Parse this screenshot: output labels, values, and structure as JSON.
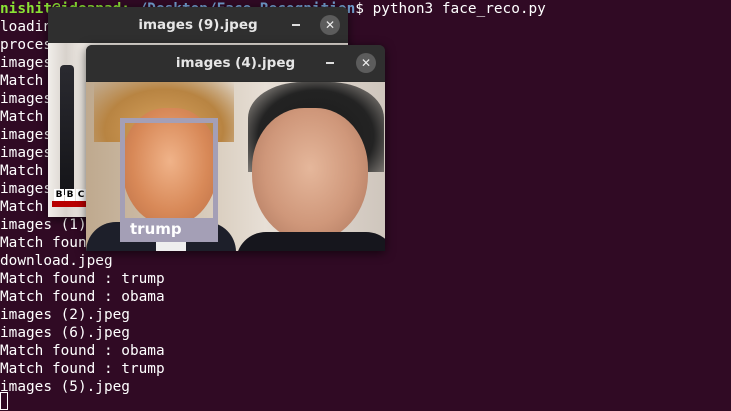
{
  "terminal": {
    "prompt_user": "nishit@ideapad",
    "prompt_sep": ":",
    "prompt_path": "~/Desktop/Face_Recognition",
    "prompt_end": "$",
    "command": " python3 face_reco.py",
    "lines": [
      "loading encodings...",
      "processing images...",
      "images (9).jpeg",
      "Match found : trump",
      "images (8).jpeg",
      "Match found : obama",
      "images (7).jpeg",
      "images (3).jpeg",
      "Match found : trump",
      "images (4).jpeg",
      "Match found : trump",
      "images (1).jpeg",
      "Match found : obama",
      "download.jpeg",
      "Match found : trump",
      "Match found : obama",
      "images (2).jpeg",
      "images (6).jpeg",
      "Match found : obama",
      "Match found : trump",
      "images (5).jpeg"
    ]
  },
  "windows": {
    "back": {
      "title": "images (9).jpeg",
      "minimize_label": "–",
      "close_label": "✕",
      "logo_letters": [
        "B",
        "B",
        "C"
      ]
    },
    "front": {
      "title": "images (4).jpeg",
      "minimize_label": "–",
      "close_label": "✕",
      "detection_label": "trump"
    }
  },
  "colors": {
    "terminal_bg": "#300a24",
    "prompt_user": "#8ae234",
    "prompt_path": "#729fcf",
    "detection_box": "#a49fb6"
  }
}
